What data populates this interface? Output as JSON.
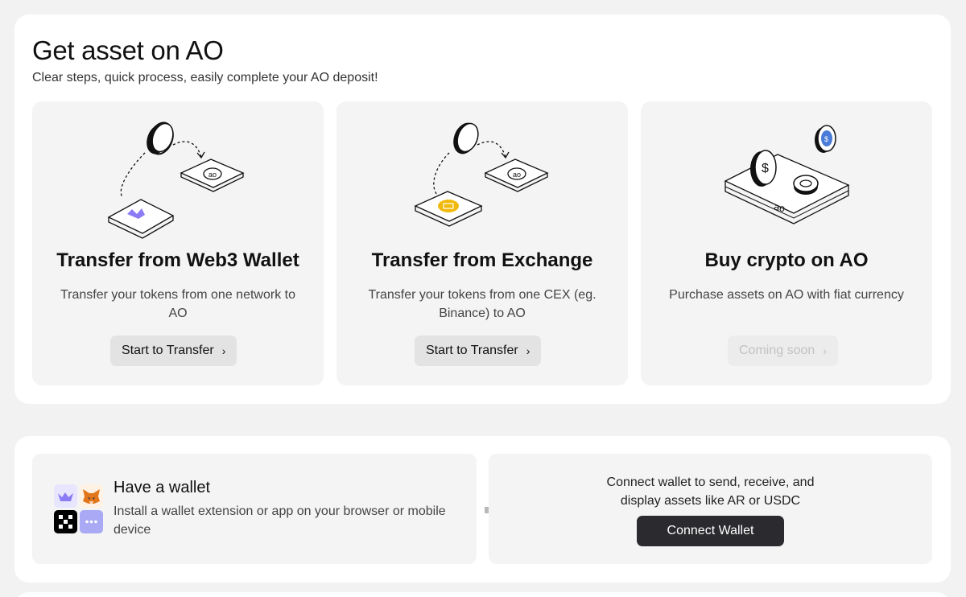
{
  "header": {
    "title": "Get asset on AO",
    "subtitle": "Clear steps, quick process, easily complete your AO deposit!"
  },
  "cards": [
    {
      "title": "Transfer from Web3 Wallet",
      "description": "Transfer your tokens from one network to AO",
      "button_label": "Start to Transfer",
      "button_icon": "chevron-right-icon",
      "enabled": true
    },
    {
      "title": "Transfer from Exchange",
      "description": "Transfer your tokens from one CEX (eg. Binance) to AO",
      "button_label": "Start to Transfer",
      "button_icon": "chevron-right-icon",
      "enabled": true
    },
    {
      "title": "Buy crypto on AO",
      "description": "Purchase assets on AO with fiat currency",
      "button_label": "Coming soon",
      "button_icon": "chevron-right-icon",
      "enabled": false
    }
  ],
  "wallet": {
    "title": "Have a wallet",
    "description": "Install a wallet extension or app on your browser or mobile device",
    "icons": [
      "wander-icon",
      "metamask-fox-icon",
      "okx-icon",
      "more-wallets-icon"
    ]
  },
  "connect": {
    "text": "Connect wallet to send, receive, and display assets like AR or USDC",
    "button_label": "Connect Wallet"
  },
  "colors": {
    "page_bg": "#f2f2f2",
    "card_bg": "#f4f4f4",
    "button_bg": "#e3e3e3",
    "primary_button": "#2b2b2f",
    "wander_purple": "#8b7cf6",
    "exchange_gold": "#f0b90b"
  }
}
